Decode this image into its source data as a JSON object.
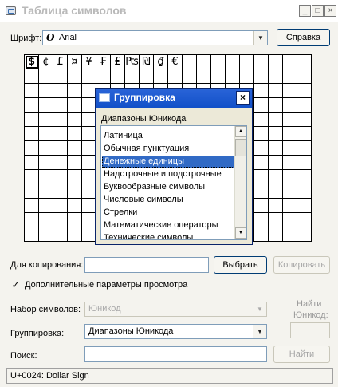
{
  "window": {
    "title": "Таблица символов",
    "minimize_glyph": "_",
    "maximize_glyph": "□",
    "close_glyph": "×"
  },
  "font_row": {
    "label": "Шрифт:",
    "font_glyph": "O",
    "value": "Arial",
    "arrow": "▼",
    "help_button": "Справка"
  },
  "grid": {
    "cells": [
      "$",
      "¢",
      "£",
      "¤",
      "¥",
      "₣",
      "₤",
      "₧",
      "₪",
      "₫",
      "€"
    ],
    "selected_index": 0
  },
  "copy_row": {
    "label": "Для копирования:",
    "value": "",
    "select_button": "Выбрать",
    "copy_button": "Копировать"
  },
  "advanced": {
    "checked": true,
    "check_glyph": "✓",
    "label": "Дополнительные параметры просмотра"
  },
  "charset_row": {
    "label": "Набор символов:",
    "value": "Юникод",
    "arrow": "▼"
  },
  "find_label": {
    "line1": "Найти",
    "line2": "Юникод:"
  },
  "grouping_row": {
    "label": "Группировка:",
    "value": "Диапазоны Юникода",
    "arrow": "▼"
  },
  "search_row": {
    "label": "Поиск:",
    "value": "",
    "find_button": "Найти"
  },
  "status": {
    "text": "U+0024: Dollar Sign"
  },
  "popup": {
    "title": "Группировка",
    "close_glyph": "×",
    "subtitle": "Диапазоны Юникода",
    "scroll_up": "▲",
    "scroll_down": "▼",
    "items": [
      "Латиница",
      "Обычная пунктуация",
      "Денежные единицы",
      "Надстрочные и подстрочные",
      "Буквообразные символы",
      "Числовые символы",
      "Стрелки",
      "Математические операторы",
      "Технические символы"
    ],
    "selected_index": 2
  }
}
